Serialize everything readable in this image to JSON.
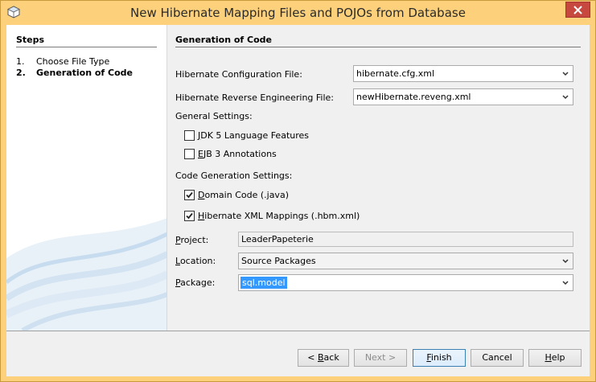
{
  "window": {
    "title": "New Hibernate Mapping Files and POJOs from Database"
  },
  "steps": {
    "heading": "Steps",
    "items": [
      {
        "num": "1.",
        "label": "Choose File Type"
      },
      {
        "num": "2.",
        "label": "Generation of Code"
      }
    ]
  },
  "main": {
    "heading": "Generation of Code",
    "config_file": {
      "label": "Hibernate Configuration File:",
      "value": "hibernate.cfg.xml"
    },
    "reveng_file": {
      "label": "Hibernate Reverse Engineering File:",
      "value": "newHibernate.reveng.xml"
    },
    "general_settings": {
      "label": "General Settings:",
      "jdk5": {
        "mnemonic": "J",
        "rest": "DK 5 Language Features",
        "checked": false
      },
      "ejb3": {
        "mnemonic": "E",
        "rest": "JB 3 Annotations",
        "checked": false
      }
    },
    "code_generation": {
      "label": "Code Generation Settings:",
      "domain_code": {
        "mnemonic": "D",
        "rest": "omain Code (.java)",
        "checked": true
      },
      "xml_mappings": {
        "mnemonic": "H",
        "rest": "ibernate XML Mappings (.hbm.xml)",
        "checked": true
      }
    },
    "project": {
      "mnemonic": "P",
      "rest": "roject:",
      "value": "LeaderPapeterie"
    },
    "location": {
      "mnemonic": "L",
      "rest": "ocation:",
      "value": "Source Packages"
    },
    "package": {
      "mnemonic": "P",
      "rest": "ackage:",
      "value": "sql.model"
    }
  },
  "buttons": {
    "back": {
      "prefix": "< ",
      "mnemonic": "B",
      "rest": "ack"
    },
    "next": {
      "label": "Next >"
    },
    "finish": {
      "mnemonic": "F",
      "rest": "inish"
    },
    "cancel": {
      "label": "Cancel"
    },
    "help": {
      "mnemonic": "H",
      "rest": "elp"
    }
  },
  "colors": {
    "titlebar": "#fdd07c",
    "close_button": "#c7483f",
    "selection": "#3399ff",
    "primary_border": "#3c7fb1"
  }
}
